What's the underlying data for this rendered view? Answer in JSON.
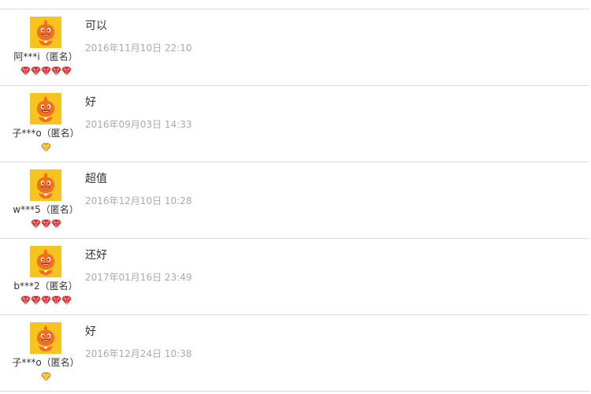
{
  "reviews": [
    {
      "username": "阿***i（匿名）",
      "text": "可以",
      "date": "2016年11月10日 22:10",
      "badge_type": "red-diamond",
      "badge_count": 5,
      "avatar_icon": "orange-mascot-avatar-icon"
    },
    {
      "username": "子***o（匿名）",
      "text": "好",
      "date": "2016年09月03日 14:33",
      "badge_type": "yellow-diamond",
      "badge_count": 1,
      "avatar_icon": "orange-mascot-avatar-icon"
    },
    {
      "username": "w***5（匿名）",
      "text": "超值",
      "date": "2016年12月10日 10:28",
      "badge_type": "red-diamond",
      "badge_count": 3,
      "avatar_icon": "orange-mascot-avatar-icon"
    },
    {
      "username": "b***2（匿名）",
      "text": "还好",
      "date": "2017年01月16日 23:49",
      "badge_type": "red-diamond",
      "badge_count": 5,
      "avatar_icon": "orange-mascot-avatar-icon"
    },
    {
      "username": "子***o（匿名）",
      "text": "好",
      "date": "2016年12月24日 10:38",
      "badge_type": "yellow-diamond",
      "badge_count": 1,
      "avatar_icon": "orange-mascot-avatar-icon"
    }
  ],
  "colors": {
    "divider": "#dcdcdc",
    "text": "#333333",
    "date": "#aaaaaa",
    "avatar_bg": "#f7c41f",
    "mascot": "#f26f21",
    "red_diamond": "#e02828",
    "yellow_diamond": "#f5b800"
  }
}
